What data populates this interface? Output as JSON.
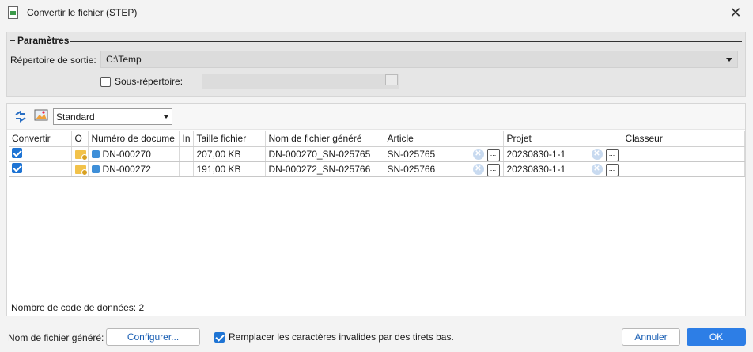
{
  "window": {
    "title": "Convertir le fichier (STEP)",
    "close_glyph": "✕",
    "icon": "step-file-icon"
  },
  "params": {
    "legend": "Paramètres",
    "output_dir_label": "Répertoire de sortie:",
    "output_dir_value": "C:\\Temp",
    "subdir_label": "Sous-répertoire:",
    "subdir_checked": false,
    "subdir_value": "",
    "subdir_browse": "..."
  },
  "toolbar": {
    "view_selected": "Standard"
  },
  "grid": {
    "columns": [
      "Convertir",
      "O",
      "Numéro de docume",
      "In",
      "Taille fichier",
      "Nom de fichier généré",
      "Article",
      "Projet",
      "Classeur"
    ],
    "rows": [
      {
        "convertir": true,
        "numero": "DN-000270",
        "in": "",
        "taille": "207,00 KB",
        "nom": "DN-000270_SN-025765",
        "article": "SN-025765",
        "projet": "20230830-1-1",
        "classeur": ""
      },
      {
        "convertir": true,
        "numero": "DN-000272",
        "in": "",
        "taille": "191,00 KB",
        "nom": "DN-000272_SN-025766",
        "article": "SN-025766",
        "projet": "20230830-1-1",
        "classeur": ""
      }
    ],
    "clear_glyph": "✕",
    "browse_glyph": "..."
  },
  "footer": {
    "count_text": "Nombre de code de données: 2"
  },
  "bottom": {
    "genname_label": "Nom de fichier généré:",
    "configure_label": "Configurer...",
    "replace_label": "Remplacer les caractères invalides par des tirets bas.",
    "replace_checked": true,
    "cancel_label": "Annuler",
    "ok_label": "OK"
  },
  "colors": {
    "accent": "#2d7ee6",
    "checkbox_checked": "#1e74d4",
    "folder": "#f2c24a",
    "doc": "#3f8fd8"
  }
}
